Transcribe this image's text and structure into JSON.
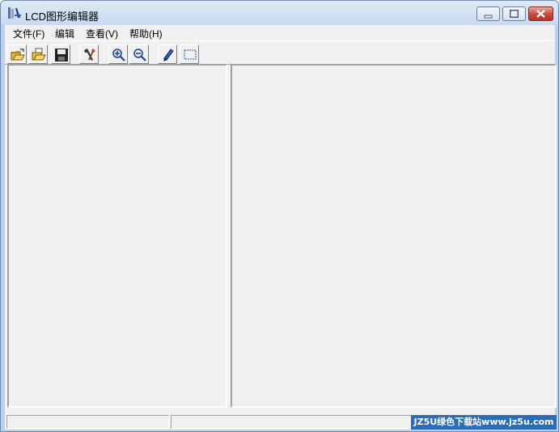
{
  "window": {
    "title": "LCD图形编辑器"
  },
  "menubar": {
    "items": [
      "文件(F)",
      "编辑",
      "查看(V)",
      "帮助(H)"
    ]
  },
  "toolbar": {
    "buttons": [
      "open-folder-icon",
      "open-file-icon",
      "save-icon",
      "tools-icon",
      "zoom-in-icon",
      "zoom-out-icon",
      "pencil-icon",
      "selection-rectangle-icon"
    ]
  },
  "statusbar": {
    "field1": "",
    "field2": ""
  },
  "watermark": {
    "text": "JZ5U绿色下载站www.jz5u.com"
  },
  "colors": {
    "titlebar": "#c9daf0",
    "client": "#f0f0f0",
    "close_button": "#c7483a",
    "watermark_bg": "#2a6db5"
  }
}
